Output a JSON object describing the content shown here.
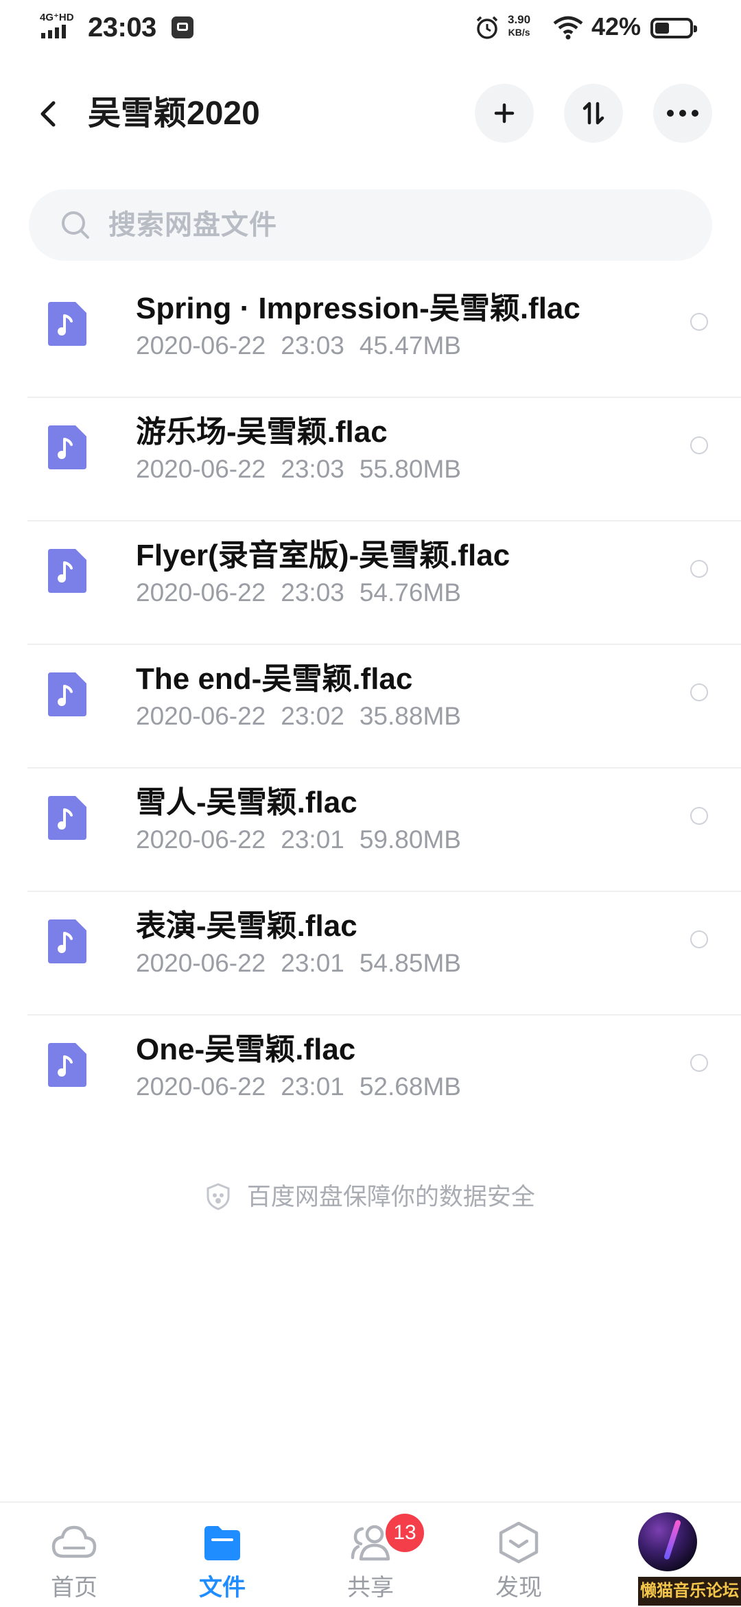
{
  "status_bar": {
    "network": "4G⁺HD",
    "time": "23:03",
    "speed_value": "3.90",
    "speed_unit": "KB/s",
    "battery_percent": "42%"
  },
  "header": {
    "title": "吴雪颖2020",
    "back_icon": "chevron-left-icon",
    "add_icon": "plus-icon",
    "sort_icon": "sort-icon",
    "more_icon": "more-icon"
  },
  "search": {
    "placeholder": "搜索网盘文件"
  },
  "files": [
    {
      "name": "Spring · Impression-吴雪颖.flac",
      "date": "2020-06-22",
      "time": "23:03",
      "size": "45.47MB"
    },
    {
      "name": "游乐场-吴雪颖.flac",
      "date": "2020-06-22",
      "time": "23:03",
      "size": "55.80MB"
    },
    {
      "name": "Flyer(录音室版)-吴雪颖.flac",
      "date": "2020-06-22",
      "time": "23:03",
      "size": "54.76MB"
    },
    {
      "name": "The end-吴雪颖.flac",
      "date": "2020-06-22",
      "time": "23:02",
      "size": "35.88MB"
    },
    {
      "name": "雪人-吴雪颖.flac",
      "date": "2020-06-22",
      "time": "23:01",
      "size": "59.80MB"
    },
    {
      "name": "表演-吴雪颖.flac",
      "date": "2020-06-22",
      "time": "23:01",
      "size": "54.85MB"
    },
    {
      "name": "One-吴雪颖.flac",
      "date": "2020-06-22",
      "time": "23:01",
      "size": "52.68MB"
    }
  ],
  "footer_note": "百度网盘保障你的数据安全",
  "bottom_nav": {
    "home": "首页",
    "files": "文件",
    "share": "共享",
    "discover": "发现",
    "share_badge": "13"
  },
  "watermark": "懒猫音乐论坛",
  "colors": {
    "accent": "#1f8cff",
    "file_icon": "#7b7fe8",
    "badge": "#f43f4b"
  }
}
